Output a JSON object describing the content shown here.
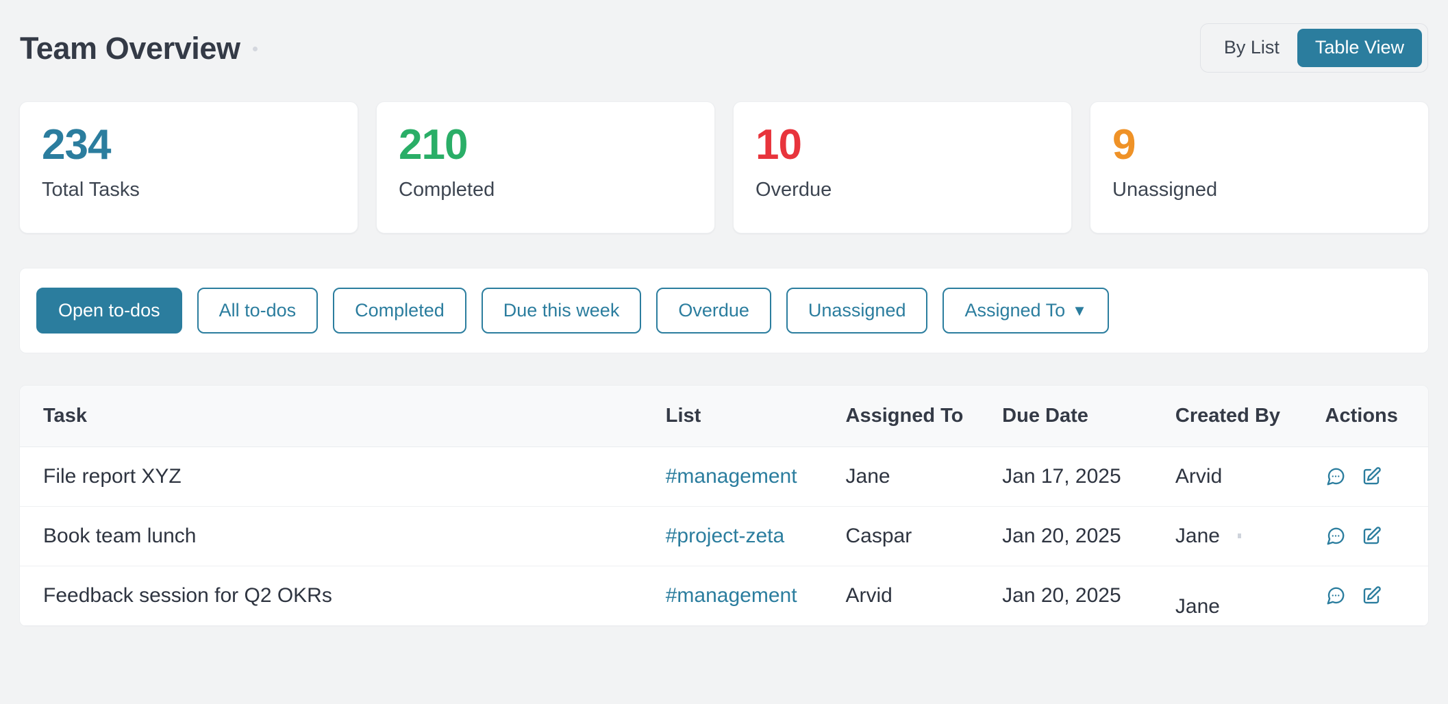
{
  "header": {
    "title": "Team Overview",
    "view_toggle": {
      "options": [
        {
          "label": "By List",
          "active": false
        },
        {
          "label": "Table View",
          "active": true
        }
      ]
    }
  },
  "stats": [
    {
      "value": "234",
      "label": "Total Tasks",
      "color": "#2b7d9e"
    },
    {
      "value": "210",
      "label": "Completed",
      "color": "#2aae67"
    },
    {
      "value": "10",
      "label": "Overdue",
      "color": "#e8343c"
    },
    {
      "value": "9",
      "label": "Unassigned",
      "color": "#ef9227"
    }
  ],
  "filters": [
    {
      "label": "Open to-dos",
      "active": true,
      "has_caret": false
    },
    {
      "label": "All to-dos",
      "active": false,
      "has_caret": false
    },
    {
      "label": "Completed",
      "active": false,
      "has_caret": false
    },
    {
      "label": "Due this week",
      "active": false,
      "has_caret": false
    },
    {
      "label": "Overdue",
      "active": false,
      "has_caret": false
    },
    {
      "label": "Unassigned",
      "active": false,
      "has_caret": false
    },
    {
      "label": "Assigned To",
      "active": false,
      "has_caret": true,
      "caret": "▼"
    }
  ],
  "table": {
    "columns": [
      "Task",
      "List",
      "Assigned To",
      "Due Date",
      "Created By",
      "Actions"
    ],
    "rows": [
      {
        "task": "File report XYZ",
        "list": "#management",
        "assigned_to": "Jane",
        "due_date": "Jan 17, 2025",
        "created_by": "Arvid",
        "actions": [
          "comment-icon",
          "edit-icon"
        ]
      },
      {
        "task": "Book team lunch",
        "list": "#project-zeta",
        "assigned_to": "Caspar",
        "due_date": "Jan 20, 2025",
        "created_by": "Jane",
        "actions": [
          "comment-icon",
          "edit-icon"
        ]
      },
      {
        "task": "Feedback session for Q2 OKRs",
        "list": "#management",
        "assigned_to": "Arvid",
        "due_date": "Jan 20, 2025",
        "created_by": "Jane",
        "actions": [
          "comment-icon",
          "edit-icon"
        ]
      }
    ]
  },
  "theme": {
    "accent": "#2b7d9e",
    "page_bg": "#f2f3f4",
    "card_bg": "#ffffff",
    "text": "#2e3440",
    "header_bg": "#f8f9fa"
  }
}
